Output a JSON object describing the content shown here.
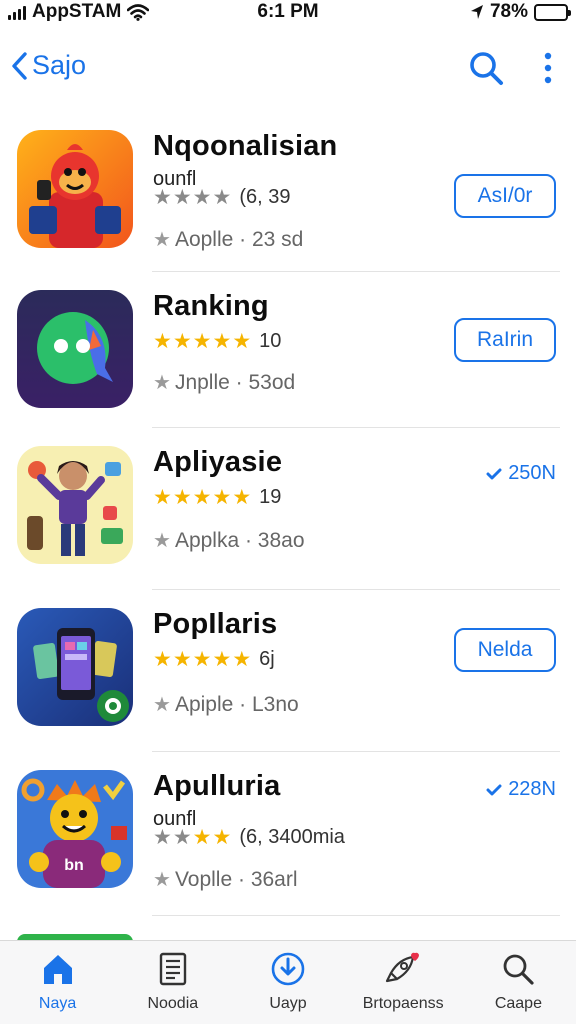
{
  "status_bar": {
    "carrier": "AppSTAM",
    "time": "6:1 PM",
    "battery": "78%",
    "battery_level": 0.78
  },
  "nav": {
    "back_label": "Sajo"
  },
  "apps": [
    {
      "name": "Nqoonalisian",
      "subtitle": "ounfl",
      "rating_text": "(6, 39",
      "stars_filled": 4,
      "star_style": "grey",
      "developer": "Aoplle · 23 sd",
      "action": {
        "type": "button",
        "label": "AsI​/0r"
      }
    },
    {
      "name": "Ranking",
      "subtitle": "",
      "rating_text": "10",
      "stars_filled": 5,
      "star_style": "gold",
      "developer": "Jnplle · 53od",
      "action": {
        "type": "button",
        "label": "RaIrin"
      }
    },
    {
      "name": "Apliyasie",
      "subtitle": "",
      "rating_text": "19",
      "stars_filled": 5,
      "star_style": "gold",
      "developer": "Applka · 38ao",
      "action": {
        "type": "downloaded",
        "label": "250N"
      }
    },
    {
      "name": "PopIlaris",
      "subtitle": "",
      "rating_text": "6j",
      "stars_filled": 5,
      "star_style": "gold",
      "developer": "Apiple · L3no",
      "action": {
        "type": "button",
        "label": "Nelda"
      }
    },
    {
      "name": "Apulluria",
      "subtitle": "ounfl",
      "rating_text": "(6, 3400mia",
      "stars_filled": 4,
      "star_style": "mixed",
      "developer": "Voplle · 36arl",
      "action": {
        "type": "downloaded",
        "label": "228N"
      }
    }
  ],
  "tabs": [
    {
      "label": "Naya",
      "icon": "home-icon",
      "active": true
    },
    {
      "label": "Noodia",
      "icon": "news-icon",
      "active": false
    },
    {
      "label": "Uayp",
      "icon": "download-icon",
      "active": false
    },
    {
      "label": "Brtopaenss",
      "icon": "rocket-icon",
      "active": false
    },
    {
      "label": "Caape",
      "icon": "search-icon",
      "active": false
    }
  ],
  "colors": {
    "accent": "#1a73e8",
    "star": "#f5b400",
    "divider": "#e3e3e3"
  }
}
